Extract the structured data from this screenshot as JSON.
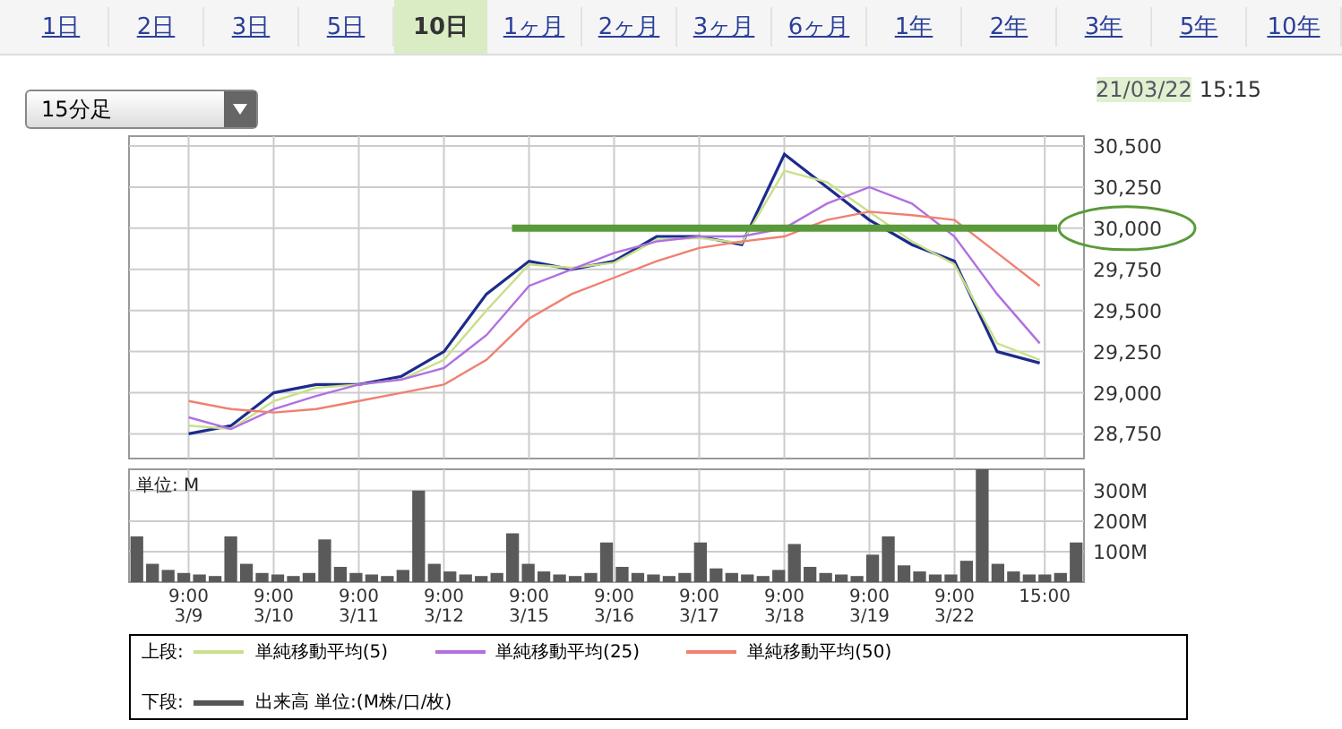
{
  "tabs": [
    {
      "label": "1日",
      "selected": false
    },
    {
      "label": "2日",
      "selected": false
    },
    {
      "label": "3日",
      "selected": false
    },
    {
      "label": "5日",
      "selected": false
    },
    {
      "label": "10日",
      "selected": true
    },
    {
      "label": "1ヶ月",
      "selected": false
    },
    {
      "label": "2ヶ月",
      "selected": false
    },
    {
      "label": "3ヶ月",
      "selected": false
    },
    {
      "label": "6ヶ月",
      "selected": false
    },
    {
      "label": "1年",
      "selected": false
    },
    {
      "label": "2年",
      "selected": false
    },
    {
      "label": "3年",
      "selected": false
    },
    {
      "label": "5年",
      "selected": false
    },
    {
      "label": "10年",
      "selected": false
    }
  ],
  "interval_select": {
    "value": "15分足"
  },
  "timestamp": {
    "date": "21/03/22",
    "time": "15:15"
  },
  "price_chart": {
    "chart_data": {
      "type": "line",
      "grid": true,
      "ylim": [
        28600,
        30560
      ],
      "yticks": [
        {
          "value": 28750,
          "label": "28,750"
        },
        {
          "value": 29000,
          "label": "29,000"
        },
        {
          "value": 29250,
          "label": "29,250"
        },
        {
          "value": 29500,
          "label": "29,500"
        },
        {
          "value": 29750,
          "label": "29,750"
        },
        {
          "value": 30000,
          "label": "30,000"
        },
        {
          "value": 30250,
          "label": "30,250"
        },
        {
          "value": 30500,
          "label": "30,500"
        }
      ],
      "series": [
        {
          "color": "#1c2c8c",
          "values": [
            28750,
            28800,
            29000,
            29050,
            29050,
            29100,
            29250,
            29600,
            29800,
            29750,
            29800,
            29950,
            29950,
            29900,
            30450,
            30250,
            30050,
            29900,
            29800,
            29250,
            29180
          ]
        },
        {
          "name": "単純移動平均(5)",
          "color": "#c8e08a",
          "values": [
            28800,
            28780,
            28950,
            29030,
            29050,
            29080,
            29200,
            29500,
            29780,
            29760,
            29790,
            29930,
            29940,
            29910,
            30350,
            30280,
            30100,
            29920,
            29780,
            29300,
            29200
          ]
        },
        {
          "name": "単純移動平均(25)",
          "color": "#b070e0",
          "values": [
            28850,
            28780,
            28900,
            28980,
            29050,
            29080,
            29150,
            29350,
            29650,
            29750,
            29850,
            29920,
            29950,
            29950,
            30000,
            30150,
            30250,
            30150,
            29950,
            29600,
            29300
          ]
        },
        {
          "name": "単純移動平均(50)",
          "color": "#f08070",
          "values": [
            28950,
            28900,
            28880,
            28900,
            28950,
            29000,
            29050,
            29200,
            29450,
            29600,
            29700,
            29800,
            29880,
            29920,
            29950,
            30050,
            30100,
            30080,
            30050,
            29850,
            29650
          ]
        }
      ],
      "ref_lines": [
        {
          "axis": "y",
          "value": 30000,
          "color": "#5a9a3a"
        }
      ]
    }
  },
  "volume_chart": {
    "unit_label": "単位: M",
    "chart_data": {
      "type": "bar",
      "grid": true,
      "ylim": [
        0,
        370
      ],
      "yticks": [
        {
          "value": 100,
          "label": "100M"
        },
        {
          "value": 200,
          "label": "200M"
        },
        {
          "value": 300,
          "label": "300M"
        }
      ],
      "values": [
        150,
        60,
        40,
        30,
        25,
        20,
        150,
        60,
        30,
        25,
        20,
        30,
        140,
        50,
        30,
        25,
        20,
        40,
        300,
        60,
        35,
        25,
        20,
        30,
        160,
        60,
        35,
        25,
        20,
        30,
        130,
        50,
        30,
        25,
        20,
        30,
        130,
        45,
        30,
        25,
        20,
        40,
        125,
        50,
        30,
        25,
        20,
        90,
        150,
        55,
        35,
        25,
        25,
        70,
        370,
        60,
        35,
        25,
        25,
        30,
        130
      ]
    }
  },
  "time_axis": [
    {
      "time": "9:00",
      "date": "3/9"
    },
    {
      "time": "9:00",
      "date": "3/10"
    },
    {
      "time": "9:00",
      "date": "3/11"
    },
    {
      "time": "9:00",
      "date": "3/12"
    },
    {
      "time": "9:00",
      "date": "3/15"
    },
    {
      "time": "9:00",
      "date": "3/16"
    },
    {
      "time": "9:00",
      "date": "3/17"
    },
    {
      "time": "9:00",
      "date": "3/18"
    },
    {
      "time": "9:00",
      "date": "3/19"
    },
    {
      "time": "9:00",
      "date": "3/22"
    },
    {
      "time": "15:00"
    }
  ],
  "legend": {
    "upper_label": "上段:",
    "lower": {
      "label": "下段:",
      "items": [
        {
          "name": "出来高 単位:(M株/口/枚)",
          "color": "#555555"
        }
      ]
    }
  }
}
